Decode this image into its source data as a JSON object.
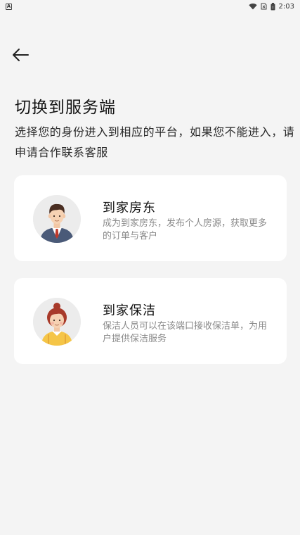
{
  "status_bar": {
    "time": "2:03",
    "notification_icon": "a-notification-icon",
    "icons": [
      "wifi-icon",
      "no-sim-icon",
      "battery-icon"
    ]
  },
  "header": {
    "back_icon": "arrow-left-icon"
  },
  "page": {
    "title": "切换到服务端",
    "description": "选择您的身份进入到相应的平台，如果您不能进入，请申请合作联系客服"
  },
  "options": [
    {
      "title": "到家房东",
      "description": "成为到家房东，发布个人房源，获取更多的订单与客户",
      "avatar": "male-businessman-avatar"
    },
    {
      "title": "到家保洁",
      "description": "保洁人员可以在该端口接收保洁单，为用户提供保洁服务",
      "avatar": "female-cleaner-avatar"
    }
  ],
  "colors": {
    "background": "#f4f4f4",
    "card": "#ffffff",
    "title_text": "#111111",
    "secondary_text": "#8a8a8a"
  }
}
